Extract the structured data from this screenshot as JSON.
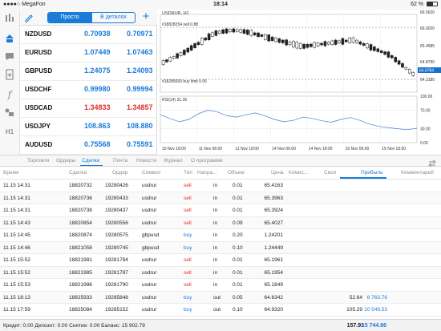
{
  "status_bar": {
    "carrier": "MegaFon",
    "time": "18:14",
    "battery": "62 %",
    "battery_level": 0.62
  },
  "sidebar": {
    "items": [
      {
        "name": "quotes-icon",
        "active": false
      },
      {
        "name": "trade-icon",
        "active": true
      },
      {
        "name": "chat-icon",
        "active": false
      },
      {
        "name": "new-order-icon",
        "active": false
      },
      {
        "name": "indicator-icon",
        "active": false
      },
      {
        "name": "objects-icon",
        "active": false
      },
      {
        "name": "timeframe-icon",
        "label": "H1",
        "active": false
      }
    ]
  },
  "quotes": {
    "segments": {
      "simple": "Просто",
      "detailed": "В деталях"
    },
    "rows": [
      {
        "symbol": "NZDUSD",
        "bid": "0.70938",
        "ask": "0.70971",
        "color": "#1a7bd8"
      },
      {
        "symbol": "EURUSD",
        "bid": "1.07449",
        "ask": "1.07463",
        "color": "#1a7bd8"
      },
      {
        "symbol": "GBPUSD",
        "bid": "1.24075",
        "ask": "1.24093",
        "color": "#1a7bd8"
      },
      {
        "symbol": "USDCHF",
        "bid": "0.99980",
        "ask": "0.99994",
        "color": "#1a7bd8"
      },
      {
        "symbol": "USDCAD",
        "bid": "1.34833",
        "ask": "1.34857",
        "color": "#e0302a"
      },
      {
        "symbol": "USDJPY",
        "bid": "108.863",
        "ask": "108.880",
        "color": "#1a7bd8"
      },
      {
        "symbol": "AUDUSD",
        "bid": "0.75568",
        "ask": "0.75591",
        "color": "#1a7bd8"
      }
    ]
  },
  "chart": {
    "title": "USDRUR, H1",
    "order_label_top": "#18828254 sell 0.88",
    "order_label_bottom": "#18285693 buy limit 0.05",
    "current_price": "64.6784",
    "rsi_label": "RSI(14) 31.36",
    "price_ticks": [
      "66.5620",
      "66.0020",
      "65.4585",
      "64.8790",
      "64.3180"
    ],
    "rsi_ticks": [
      "100.00",
      "70.00",
      "30.00",
      "0.00"
    ],
    "x_ticks": [
      "10 Nov 18:00",
      "11 Nov 06:00",
      "11 Nov 18:00",
      "14 Nov 06:00",
      "14 Nov 18:00",
      "15 Nov 06:00",
      "15 Nov 18:00"
    ],
    "colors": {
      "candle": "#222222",
      "rsi_line": "#3b7fd4",
      "price_tag": "#1a6fc9"
    }
  },
  "tabs": {
    "items": [
      "Торговля",
      "Ордеры",
      "Сделки",
      "Почта",
      "Новости",
      "Журнал",
      "О программе"
    ],
    "active": "Сделки"
  },
  "trades": {
    "columns": {
      "time": "Время",
      "deal": "Сделка",
      "order": "Ордер",
      "symbol": "Символ",
      "type": "Тип",
      "direction": "Напра...",
      "volume": "Объем",
      "price": "Цена",
      "commission": "Комис...",
      "swap": "Своп",
      "profit": "Прибыль",
      "comment": "Комментарий"
    },
    "sort_column": "profit",
    "rows": [
      {
        "time": "11.15 14:31",
        "deal": "18820732",
        "order": "19280426",
        "symbol": "usdrur",
        "type": "sell",
        "direction": "in",
        "volume": "0.01",
        "price": "65.4163",
        "swap": "",
        "profit": ""
      },
      {
        "time": "11.15 14:31",
        "deal": "18820736",
        "order": "19280433",
        "symbol": "usdrur",
        "type": "sell",
        "direction": "in",
        "volume": "0.01",
        "price": "65.3963",
        "swap": "",
        "profit": ""
      },
      {
        "time": "11.15 14:31",
        "deal": "18820738",
        "order": "19280437",
        "symbol": "usdrur",
        "type": "sell",
        "direction": "in",
        "volume": "0.01",
        "price": "65.3924",
        "swap": "",
        "profit": ""
      },
      {
        "time": "11.15 14:43",
        "deal": "18820854",
        "order": "19280556",
        "symbol": "usdrur",
        "type": "sell",
        "direction": "in",
        "volume": "0.09",
        "price": "65.4027",
        "swap": "",
        "profit": ""
      },
      {
        "time": "11.15 14:45",
        "deal": "18820874",
        "order": "19280575",
        "symbol": "gbpusd",
        "type": "buy",
        "direction": "in",
        "volume": "0.20",
        "price": "1.24201",
        "swap": "",
        "profit": ""
      },
      {
        "time": "11.15 14:46",
        "deal": "18821058",
        "order": "19280745",
        "symbol": "gbpusd",
        "type": "buy",
        "direction": "in",
        "volume": "0.10",
        "price": "1.24449",
        "swap": "",
        "profit": ""
      },
      {
        "time": "11.15 15:52",
        "deal": "18821981",
        "order": "19281784",
        "symbol": "usdrur",
        "type": "sell",
        "direction": "in",
        "volume": "0.01",
        "price": "65.1961",
        "swap": "",
        "profit": ""
      },
      {
        "time": "11.15 15:52",
        "deal": "18821985",
        "order": "19281787",
        "symbol": "usdrur",
        "type": "sell",
        "direction": "in",
        "volume": "0.01",
        "price": "65.1954",
        "swap": "",
        "profit": ""
      },
      {
        "time": "11.15 15:53",
        "deal": "18821986",
        "order": "19281790",
        "symbol": "usdrur",
        "type": "sell",
        "direction": "in",
        "volume": "0.01",
        "price": "65.1849",
        "swap": "",
        "profit": ""
      },
      {
        "time": "11.15 18:13",
        "deal": "18825933",
        "order": "19285848",
        "symbol": "usdrur",
        "type": "buy",
        "direction": "out",
        "volume": "0.05",
        "price": "64.6342",
        "swap": "52.64",
        "profit": "6 763.76"
      },
      {
        "time": "11.15 17:59",
        "deal": "18825084",
        "order": "19285152",
        "symbol": "usdrur",
        "type": "buy",
        "direction": "out",
        "volume": "0.10",
        "price": "64.9320",
        "swap": "105.29",
        "profit": "10 549.53"
      }
    ]
  },
  "footer": {
    "summary": "Кредит: 0.00  Депозит: 0.00  Снятие: 0.00  Баланс: 15 902.79",
    "swap_total": "157.93",
    "profit_total": "15 744.86"
  }
}
